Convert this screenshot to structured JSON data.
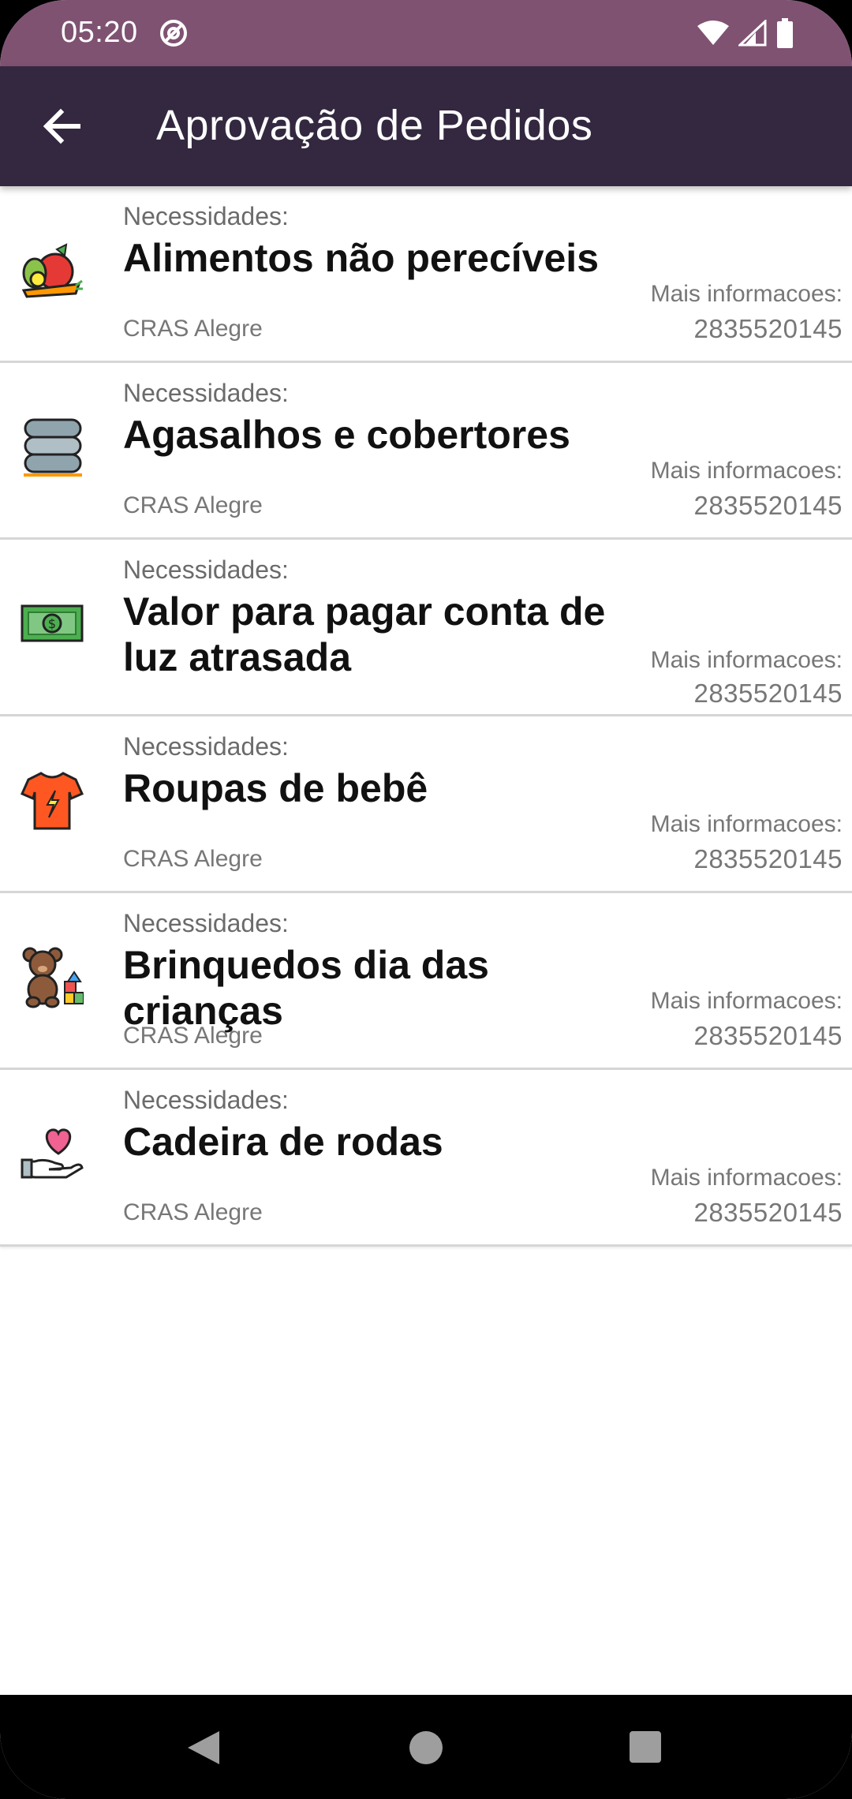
{
  "status_bar": {
    "time": "05:20"
  },
  "app_bar": {
    "title": "Aprovação de Pedidos"
  },
  "requests": [
    {
      "kicker": "Necessidades:",
      "title": "Alimentos não perecíveis",
      "org": "CRAS Alegre",
      "info_label": "Mais informacoes:",
      "phone": "2835520145",
      "icon": "food-basket-icon"
    },
    {
      "kicker": "Necessidades:",
      "title": "Agasalhos e cobertores",
      "org": "CRAS Alegre",
      "info_label": "Mais informacoes:",
      "phone": "2835520145",
      "icon": "folded-blankets-icon"
    },
    {
      "kicker": "Necessidades:",
      "title": "Valor para pagar conta de luz atrasada",
      "org": "",
      "info_label": "Mais informacoes:",
      "phone": "2835520145",
      "icon": "money-bill-icon"
    },
    {
      "kicker": "Necessidades:",
      "title": "Roupas de bebê",
      "org": "CRAS Alegre",
      "info_label": "Mais informacoes:",
      "phone": "2835520145",
      "icon": "t-shirt-icon"
    },
    {
      "kicker": "Necessidades:",
      "title": "Brinquedos dia das crianças",
      "org": "CRAS Alegre",
      "info_label": "Mais informacoes:",
      "phone": "2835520145",
      "icon": "teddy-bear-icon"
    },
    {
      "kicker": "Necessidades:",
      "title": "Cadeira de rodas",
      "org": "CRAS Alegre",
      "info_label": "Mais informacoes:",
      "phone": "2835520145",
      "icon": "heart-in-hand-icon"
    }
  ],
  "colors": {
    "status_bar": "#7f5272",
    "app_bar": "#332840",
    "title_text": "#111111",
    "muted_text": "#777777"
  }
}
